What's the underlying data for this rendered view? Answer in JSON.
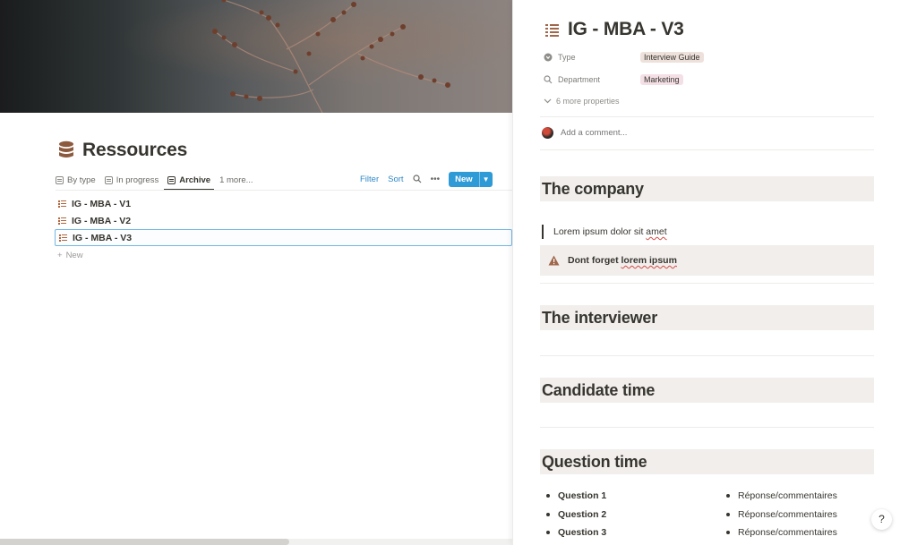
{
  "left": {
    "database_title": "Ressources",
    "views": [
      {
        "label": "By type",
        "active": false
      },
      {
        "label": "In progress",
        "active": false
      },
      {
        "label": "Archive",
        "active": true
      },
      {
        "label": "1 more...",
        "active": false
      }
    ],
    "toolbar": {
      "filter": "Filter",
      "sort": "Sort",
      "new": "New"
    },
    "rows": [
      {
        "title": "IG - MBA - V1",
        "selected": false
      },
      {
        "title": "IG - MBA - V2",
        "selected": false
      },
      {
        "title": "IG - MBA - V3",
        "selected": true
      }
    ],
    "add_new": "New"
  },
  "page": {
    "title": "IG - MBA - V3",
    "properties": [
      {
        "icon": "type-icon",
        "label": "Type",
        "value": "Interview Guide",
        "color": "#eee1dc"
      },
      {
        "icon": "search-icon",
        "label": "Department",
        "value": "Marketing",
        "color": "#f4dfe6"
      }
    ],
    "more_properties": "6 more properties",
    "comment_placeholder": "Add a comment...",
    "headings": {
      "company": "The company",
      "interviewer": "The interviewer",
      "candidate": "Candidate time",
      "questions": "Question time"
    },
    "quote": {
      "text": "Lorem ipsum dolor sit ",
      "misspelled": "amet"
    },
    "callout": {
      "text": "Dont forget ",
      "misspelled": "lorem ipsum"
    },
    "questions": [
      "Question 1",
      "Question 2",
      "Question 3"
    ],
    "answers": [
      "Réponse/commentaires",
      "Réponse/commentaires",
      "Réponse/commentaires"
    ]
  },
  "help_label": "?",
  "colors": {
    "accent": "#2e9ad6",
    "heading_bg": "#f1eeec",
    "text": "#37352f"
  }
}
